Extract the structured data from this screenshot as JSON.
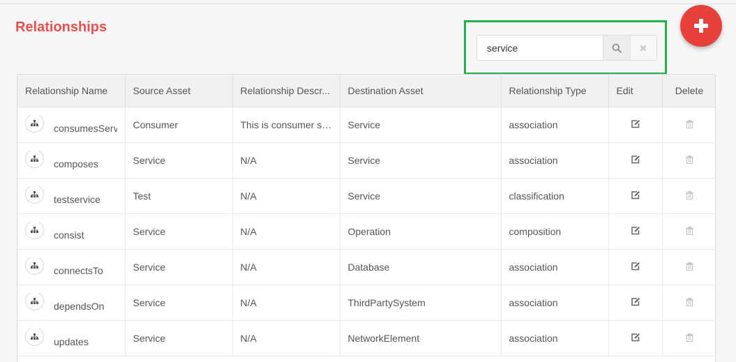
{
  "page": {
    "title": "Relationships"
  },
  "search": {
    "value": "service",
    "placeholder": ""
  },
  "table": {
    "columns": [
      "Relationship Name",
      "Source Asset",
      "Relationship Descr...",
      "Destination Asset",
      "Relationship Type",
      "Edit",
      "Delete"
    ],
    "rows": [
      {
        "name": "consumesService",
        "source": "Consumer",
        "description": "This is consumer se...",
        "destination": "Service",
        "type": "association"
      },
      {
        "name": "composes",
        "source": "Service",
        "description": "N/A",
        "destination": "Service",
        "type": "association"
      },
      {
        "name": "testservice",
        "source": "Test",
        "description": "N/A",
        "destination": "Service",
        "type": "classification"
      },
      {
        "name": "consist",
        "source": "Service",
        "description": "N/A",
        "destination": "Operation",
        "type": "composition"
      },
      {
        "name": "connectsTo",
        "source": "Service",
        "description": "N/A",
        "destination": "Database",
        "type": "association"
      },
      {
        "name": "dependsOn",
        "source": "Service",
        "description": "N/A",
        "destination": "ThirdPartySystem",
        "type": "association"
      },
      {
        "name": "updates",
        "source": "Service",
        "description": "N/A",
        "destination": "NetworkElement",
        "type": "association"
      }
    ]
  },
  "icons": {
    "add": "plus-icon",
    "search": "search-icon",
    "clear": "close-icon",
    "relationship": "hierarchy-icon",
    "edit": "edit-icon",
    "delete": "trash-icon"
  },
  "colors": {
    "title": "#e8504f",
    "add_button": "#e8413c",
    "highlight": "#22b04b"
  }
}
